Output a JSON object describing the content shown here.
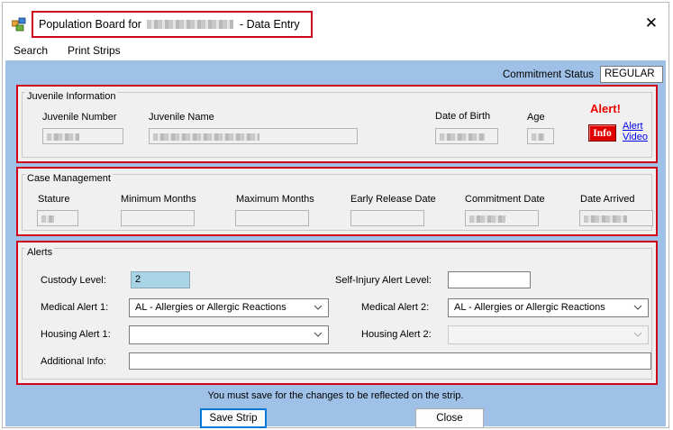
{
  "window": {
    "title_prefix": "Population Board for",
    "title_suffix": "- Data Entry",
    "close_glyph": "✕"
  },
  "menu": [
    "Search",
    "Print Strips"
  ],
  "commitment_status": {
    "label": "Commitment Status",
    "value": "REGULAR"
  },
  "juvenile_info": {
    "legend": "Juvenile Information",
    "number_label": "Juvenile Number",
    "name_label": "Juvenile Name",
    "dob_label": "Date of Birth",
    "age_label": "Age",
    "alert_title": "Alert!",
    "info_button": "Info",
    "alert_video_link": "Alert Video"
  },
  "case_management": {
    "legend": "Case Management",
    "stature_label": "Stature",
    "min_months_label": "Minimum Months",
    "max_months_label": "Maximum Months",
    "early_release_label": "Early Release Date",
    "commitment_date_label": "Commitment Date",
    "date_arrived_label": "Date Arrived"
  },
  "alerts": {
    "legend": "Alerts",
    "custody_level_label": "Custody Level:",
    "custody_level_value": "2",
    "self_injury_label": "Self-Injury Alert Level:",
    "self_injury_value": "",
    "medical_alert_1_label": "Medical Alert 1:",
    "medical_alert_1_value": "AL - Allergies or Allergic Reactions",
    "medical_alert_2_label": "Medical Alert 2:",
    "medical_alert_2_value": "AL - Allergies or Allergic Reactions",
    "housing_alert_1_label": "Housing Alert 1:",
    "housing_alert_1_value": "",
    "housing_alert_2_label": "Housing Alert 2:",
    "housing_alert_2_value": "",
    "additional_info_label": "Additional Info:",
    "additional_info_value": ""
  },
  "footer": {
    "notice": "You must save for the changes to be reflected on the strip.",
    "save_button": "Save Strip",
    "close_button": "Close"
  },
  "colors": {
    "client_bg": "#9fc1e7",
    "highlight_border": "#d0021b",
    "custody_field_bg": "#a9d4e6",
    "alert_red": "#e00000"
  },
  "icons": {
    "app": "population-board-app-icon",
    "close": "close-icon",
    "dropdown": "chevron-down-icon"
  }
}
